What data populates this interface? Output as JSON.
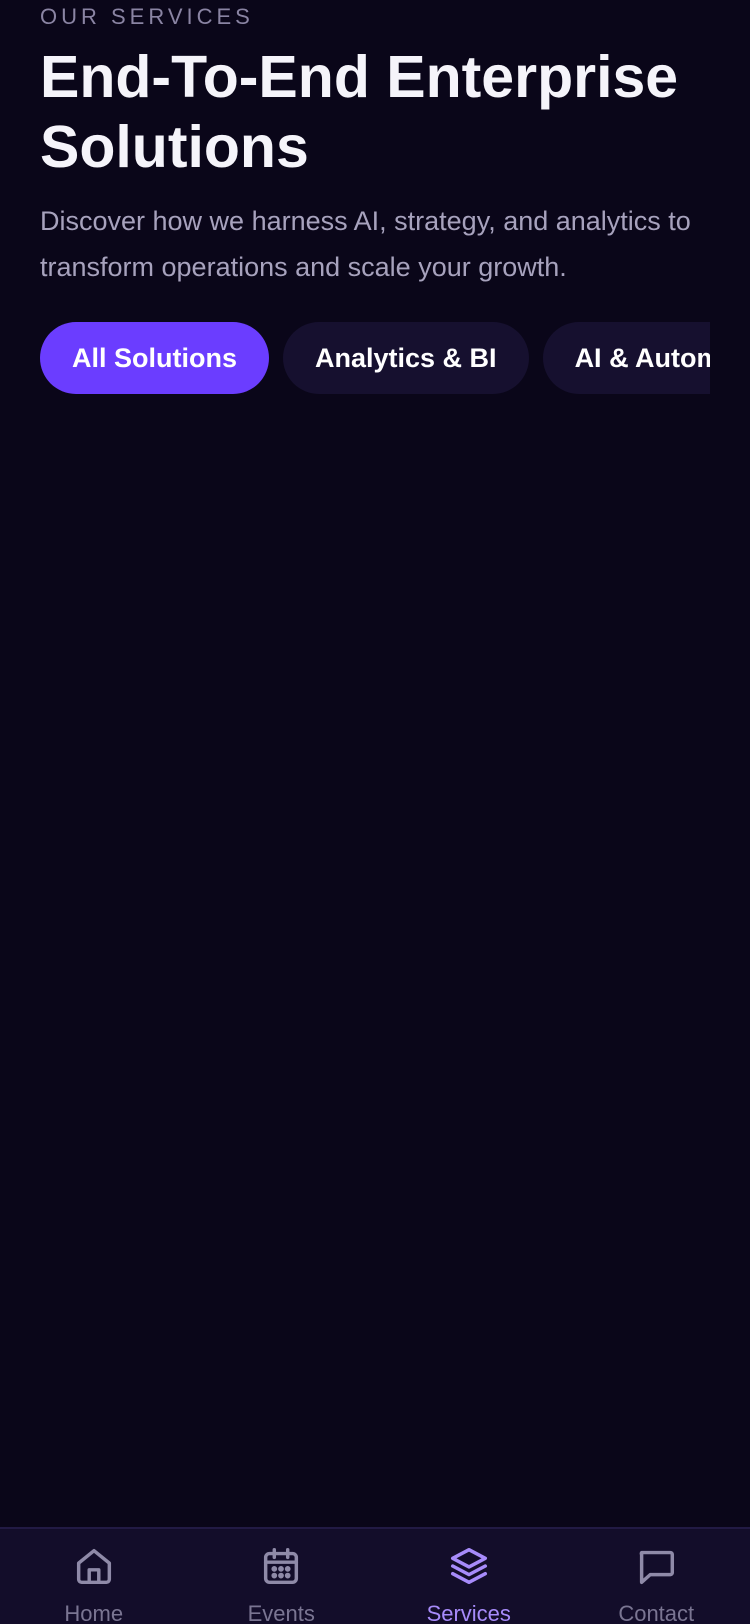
{
  "header": {
    "eyebrow": "OUR SERVICES",
    "title": "End-To-End Enterprise Solutions",
    "subtitle": "Discover how we harness AI, strategy, and analytics to transform operations and scale your growth."
  },
  "filters": {
    "items": [
      {
        "label": "All Solutions",
        "active": true
      },
      {
        "label": "Analytics & BI",
        "active": false
      },
      {
        "label": "AI & Automation",
        "active": false
      }
    ]
  },
  "tabbar": {
    "items": [
      {
        "label": "Home",
        "icon": "home-icon",
        "active": false
      },
      {
        "label": "Events",
        "icon": "calendar-icon",
        "active": false
      },
      {
        "label": "Services",
        "icon": "layers-icon",
        "active": true
      },
      {
        "label": "Contact",
        "icon": "message-icon",
        "active": false
      }
    ]
  },
  "colors": {
    "background": "#0a0619",
    "accent": "#6b3dff",
    "chip_inactive": "#16102f",
    "tab_active": "#a78bfa",
    "tab_inactive": "#7a7592"
  }
}
